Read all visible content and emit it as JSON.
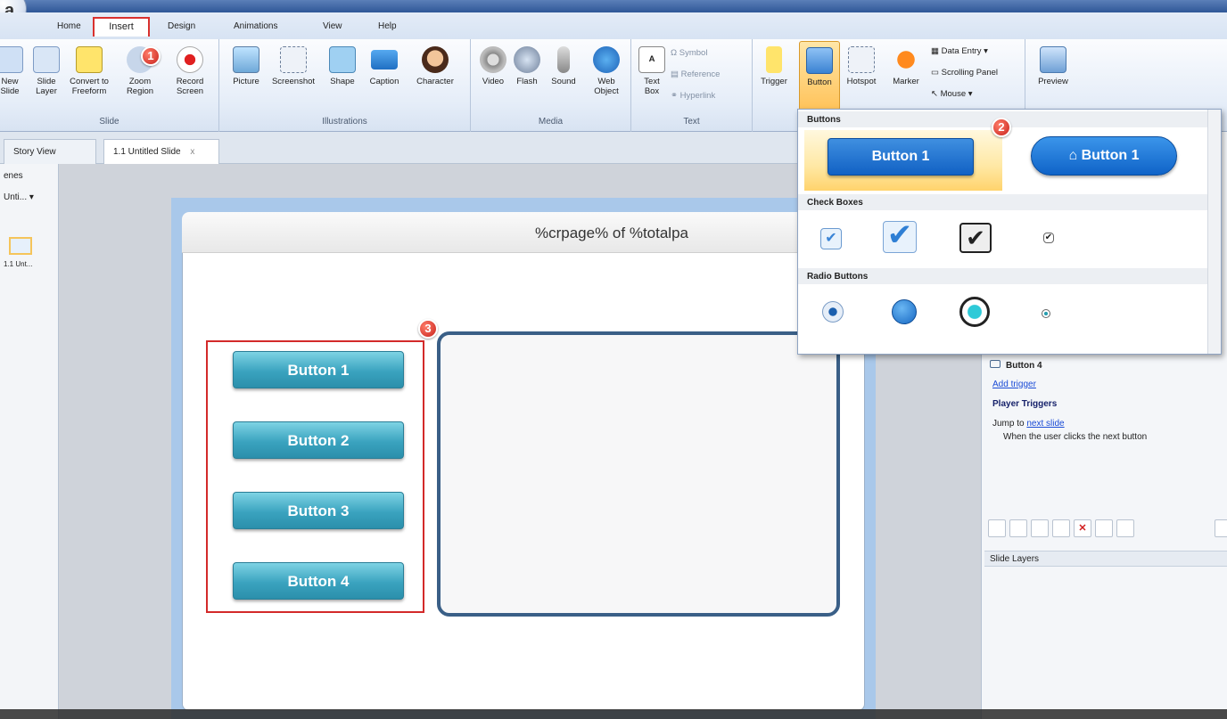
{
  "tabs": [
    "Home",
    "Insert",
    "Design",
    "Animations",
    "View",
    "Help"
  ],
  "ribbon": {
    "slide_group": {
      "label": "Slide",
      "items": [
        "New Slide",
        "Slide Layer",
        "Convert to Freeform",
        "Zoom Region",
        "Record Screen"
      ]
    },
    "illustrations_group": {
      "label": "Illustrations",
      "items": [
        "Picture",
        "Screenshot",
        "Shape",
        "Caption",
        "Character"
      ]
    },
    "media_group": {
      "label": "Media",
      "items": [
        "Video",
        "Flash",
        "Sound",
        "Web Object"
      ]
    },
    "text_group": {
      "label": "Text",
      "items": [
        "Text Box"
      ],
      "small": [
        "Symbol",
        "Reference",
        "Hyperlink"
      ]
    },
    "interactive_group": {
      "items": [
        "Trigger",
        "Button",
        "Hotspot",
        "Marker"
      ],
      "small": [
        "Data Entry",
        "Scrolling Panel",
        "Mouse"
      ]
    },
    "preview_label": "Preview"
  },
  "doc_tabs": {
    "story_view": "Story View",
    "slide_tab": "1.1 Untitled Slide",
    "close": "x"
  },
  "left_pane": {
    "header": "enes",
    "dropdown": "Unti...",
    "thumb_label": "1.1 Unt..."
  },
  "slide": {
    "title": "%crpage% of %totalpa",
    "buttons": [
      "Button 1",
      "Button 2",
      "Button 3",
      "Button 4"
    ]
  },
  "gallery": {
    "buttons_header": "Buttons",
    "button_samples": [
      "Button 1",
      "Button 1"
    ],
    "checkboxes_header": "Check Boxes",
    "radios_header": "Radio Buttons"
  },
  "right_pane": {
    "selected_item": "Button 4",
    "add_trigger": "Add trigger",
    "player_triggers": "Player Triggers",
    "jump_prefix": "Jump to",
    "jump_link": "next slide",
    "when": "When the user clicks the next button",
    "slide_layers": "Slide Layers"
  },
  "badges": [
    "1",
    "2",
    "3"
  ]
}
